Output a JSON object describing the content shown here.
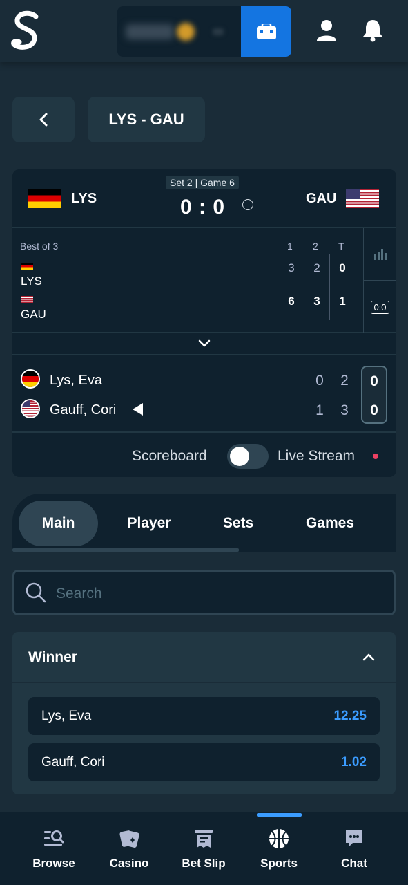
{
  "header": {
    "logo_icon": "stake-s-logo",
    "wallet_icon": "wallet-icon",
    "profile_icon": "user-icon",
    "notification_icon": "bell-icon",
    "accent": "#1475e1"
  },
  "page": {
    "title": "LYS - GAU",
    "back_icon": "chevron-left-icon"
  },
  "match": {
    "home_code": "LYS",
    "away_code": "GAU",
    "status": "Set 2 | Game 6",
    "score": "0 : 0",
    "scoreboard": {
      "format_label": "Best of 3",
      "columns": [
        "1",
        "2",
        "T"
      ],
      "rows": [
        {
          "name": "LYS",
          "sets": [
            "3",
            "2"
          ],
          "total": "0"
        },
        {
          "name": "GAU",
          "sets": [
            "6",
            "3"
          ],
          "total": "1"
        }
      ],
      "stats_icon": "bar-chart-icon",
      "score_icon_text": "0:0"
    },
    "players": [
      {
        "name": "Lys, Eva",
        "games": [
          "0",
          "2"
        ],
        "points": "0"
      },
      {
        "name": "Gauff, Cori",
        "games": [
          "1",
          "3"
        ],
        "points": "0"
      }
    ],
    "scoreboard_label": "Scoreboard",
    "live_stream_label": "Live Stream"
  },
  "tabs": [
    "Main",
    "Player",
    "Sets",
    "Games"
  ],
  "search": {
    "placeholder": "Search"
  },
  "market": {
    "title": "Winner",
    "selections": [
      {
        "name": "Lys, Eva",
        "odds": "12.25"
      },
      {
        "name": "Gauff, Cori",
        "odds": "1.02"
      }
    ]
  },
  "bottom_nav": [
    {
      "label": "Browse",
      "icon": "browse-icon"
    },
    {
      "label": "Casino",
      "icon": "casino-cards-icon"
    },
    {
      "label": "Bet Slip",
      "icon": "bet-slip-icon"
    },
    {
      "label": "Sports",
      "icon": "basketball-icon"
    },
    {
      "label": "Chat",
      "icon": "chat-icon"
    }
  ]
}
